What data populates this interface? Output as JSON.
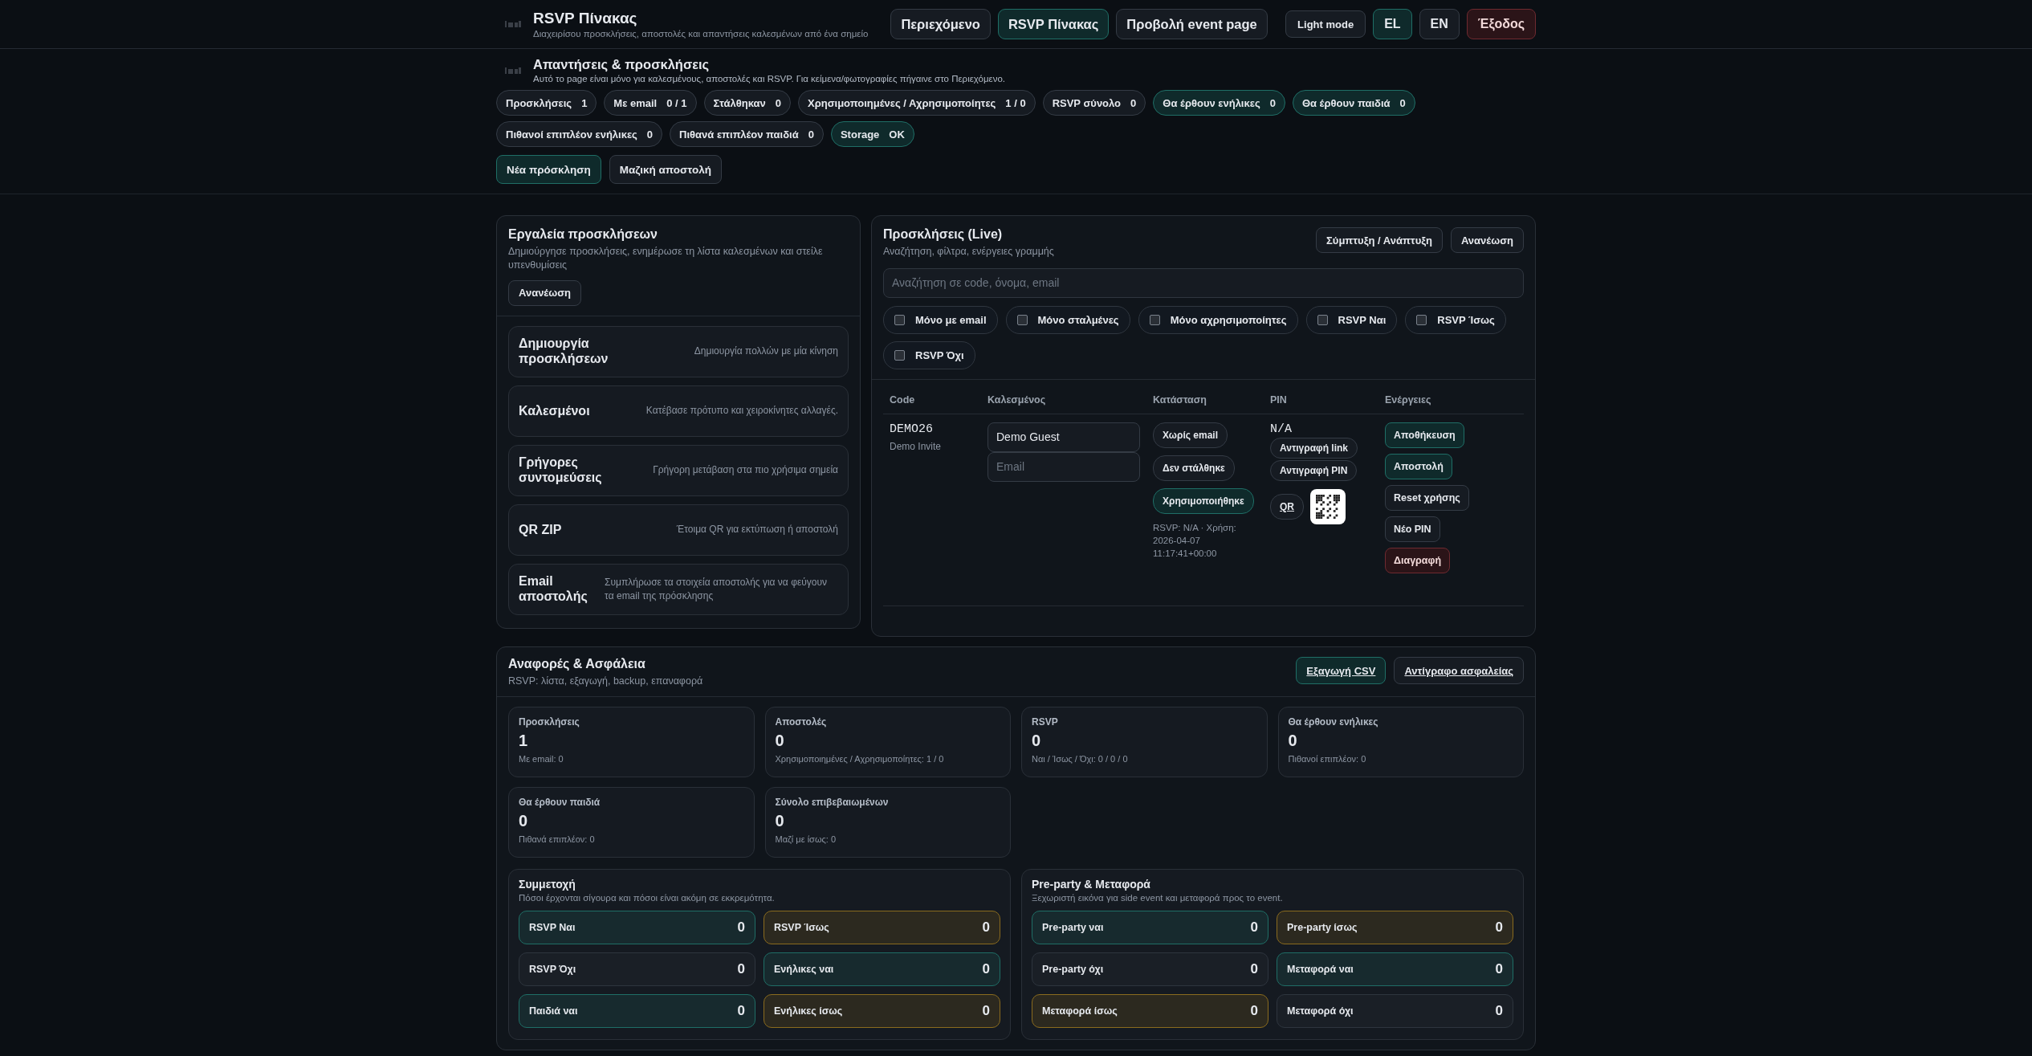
{
  "app": {
    "title": "RSVP Πίνακας",
    "subtitle": "Διαχειρίσου προσκλήσεις, αποστολές και απαντήσεις καλεσμένων από ένα σημείο"
  },
  "nav": [
    {
      "label": "Περιεχόμενο",
      "selected": false
    },
    {
      "label": "RSVP Πίνακας",
      "selected": true
    },
    {
      "label": "Προβολή event page",
      "selected": false
    }
  ],
  "theme_button": "Light mode",
  "languages": [
    {
      "label": "EL",
      "selected": true
    },
    {
      "label": "EN",
      "selected": false
    }
  ],
  "logout": "Έξοδος",
  "section": {
    "title": "Απαντήσεις & προσκλήσεις",
    "subtitle": "Αυτό το page είναι μόνο για καλεσμένους, αποστολές και RSVP. Για κείμενα/φωτογραφίες πήγαινε στο Περιεχόμενο.",
    "chips": [
      {
        "label": "Προσκλήσεις",
        "value": "1",
        "kind": "plain"
      },
      {
        "label": "Με email",
        "value": "0 / 1",
        "kind": "plain"
      },
      {
        "label": "Στάλθηκαν",
        "value": "0",
        "kind": "plain"
      },
      {
        "label": "Χρησιμοποιημένες / Αχρησιμοποίητες",
        "value": "1 / 0",
        "kind": "plain"
      },
      {
        "label": "RSVP σύνολο",
        "value": "0",
        "kind": "plain"
      },
      {
        "label": "Θα έρθουν ενήλικες",
        "value": "0",
        "kind": "accent"
      },
      {
        "label": "Θα έρθουν παιδιά",
        "value": "0",
        "kind": "accent"
      },
      {
        "label": "Πιθανοί επιπλέον ενήλικες",
        "value": "0",
        "kind": "plain"
      },
      {
        "label": "Πιθανά επιπλέον παιδιά",
        "value": "0",
        "kind": "plain"
      },
      {
        "label": "Storage",
        "value": "OK",
        "kind": "accent"
      }
    ],
    "buttons": [
      {
        "label": "Νέα πρόσκληση",
        "kind": "accent"
      },
      {
        "label": "Μαζική αποστολή",
        "kind": "plain"
      }
    ]
  },
  "tools": {
    "title": "Εργαλεία προσκλήσεων",
    "subtitle": "Δημιούργησε προσκλήσεις, ενημέρωσε τη λίστα καλεσμένων και στείλε υπενθυμίσεις",
    "button": "Ανανέωση",
    "items": [
      {
        "title": "Δημιουργία προσκλήσεων",
        "description": "Δημιουργία πολλών με μία κίνηση"
      },
      {
        "title": "Καλεσμένοι",
        "description": "Κατέβασε πρότυπο και χειροκίνητες αλλαγές."
      },
      {
        "title": "Γρήγορες συντομεύσεις",
        "description": "Γρήγορη μετάβαση στα πιο χρήσιμα σημεία"
      },
      {
        "title": "QR ZIP",
        "description": "Έτοιμα QR για εκτύπωση ή αποστολή"
      },
      {
        "title": "Email αποστολής",
        "description": "Συμπλήρωσε τα στοιχεία αποστολής για να φεύγουν τα email της πρόσκλησης"
      }
    ]
  },
  "invitations": {
    "title": "Προσκλήσεις (Live)",
    "subtitle": "Αναζήτηση, φίλτρα, ενέργειες γραμμής",
    "buttons": [
      "Σύμπτυξη / Ανάπτυξη",
      "Ανανέωση"
    ],
    "search": {
      "placeholder": "Αναζήτηση σε code, όνομα, email"
    },
    "filters": [
      {
        "label": "Μόνο με email",
        "checked": false
      },
      {
        "label": "Μόνο σταλμένες",
        "checked": false
      },
      {
        "label": "Μόνο αχρησιμοποίητες",
        "checked": false
      },
      {
        "label": "RSVP Ναι",
        "checked": false
      },
      {
        "label": "RSVP Ίσως",
        "checked": false
      },
      {
        "label": "RSVP Όχι",
        "checked": false
      }
    ],
    "columns": [
      "Code",
      "Καλεσμένος",
      "Κατάσταση",
      "PIN",
      "Ενέργειες"
    ],
    "rows": [
      {
        "code": "DEMO26",
        "invite_name": "Demo Invite",
        "guest_name": "Demo Guest",
        "email_placeholder": "Email",
        "statuses": [
          {
            "label": "Χωρίς email",
            "kind": "plain"
          },
          {
            "label": "Δεν στάλθηκε",
            "kind": "plain"
          },
          {
            "label": "Χρησιμοποιήθηκε",
            "kind": "accent"
          }
        ],
        "note": "RSVP: N/A · Χρήση: 2026-04-07 11:17:41+00:00",
        "pin": "N/A",
        "pin_buttons": [
          "Αντιγραφή link",
          "Αντιγραφή PIN"
        ],
        "qr_link": "QR",
        "actions": [
          {
            "label": "Αποθήκευση",
            "kind": "accent"
          },
          {
            "label": "Αποστολή",
            "kind": "accent"
          },
          {
            "label": "Reset χρήσης",
            "kind": "plain"
          },
          {
            "label": "Νέο PIN",
            "kind": "plain"
          },
          {
            "label": "Διαγραφή",
            "kind": "danger"
          }
        ]
      }
    ]
  },
  "reports": {
    "title": "Αναφορές & Ασφάλεια",
    "subtitle": "RSVP: λίστα, εξαγωγή, backup, επαναφορά",
    "links": [
      {
        "label": "Εξαγωγή CSV",
        "kind": "accent"
      },
      {
        "label": "Αντίγραφο ασφαλείας",
        "kind": "plain"
      }
    ],
    "stats": [
      {
        "label": "Προσκλήσεις",
        "value": "1",
        "note": "Με email: 0"
      },
      {
        "label": "Αποστολές",
        "value": "0",
        "note": "Χρησιμοποιημένες / Αχρησιμοποίητες: 1 / 0"
      },
      {
        "label": "RSVP",
        "value": "0",
        "note": "Ναι / Ίσως / Όχι: 0 / 0 / 0"
      },
      {
        "label": "Θα έρθουν ενήλικες",
        "value": "0",
        "note": "Πιθανοί επιπλέον: 0"
      },
      {
        "label": "Θα έρθουν παιδιά",
        "value": "0",
        "note": "Πιθανά επιπλέον: 0"
      },
      {
        "label": "Σύνολο επιβεβαιωμένων",
        "value": "0",
        "note": "Μαζί με ίσως: 0"
      }
    ],
    "groups": [
      {
        "title": "Συμμετοχή",
        "subtitle": "Πόσοι έρχονται σίγουρα και πόσοι είναι ακόμη σε εκκρεμότητα.",
        "tiles": [
          {
            "label": "RSVP Ναι",
            "value": "0",
            "kind": "accent"
          },
          {
            "label": "RSVP Ίσως",
            "value": "0",
            "kind": "warning"
          },
          {
            "label": "RSVP Όχι",
            "value": "0",
            "kind": "plain"
          },
          {
            "label": "Ενήλικες ναι",
            "value": "0",
            "kind": "accent"
          },
          {
            "label": "Παιδιά ναι",
            "value": "0",
            "kind": "accent"
          },
          {
            "label": "Ενήλικες ίσως",
            "value": "0",
            "kind": "warning"
          }
        ]
      },
      {
        "title": "Pre-party & Μεταφορά",
        "subtitle": "Ξεχωριστή εικόνα για side event και μεταφορά προς το event.",
        "tiles": [
          {
            "label": "Pre-party ναι",
            "value": "0",
            "kind": "accent"
          },
          {
            "label": "Pre-party ίσως",
            "value": "0",
            "kind": "warning"
          },
          {
            "label": "Pre-party όχι",
            "value": "0",
            "kind": "plain"
          },
          {
            "label": "Μεταφορά ναι",
            "value": "0",
            "kind": "accent"
          },
          {
            "label": "Μεταφορά ίσως",
            "value": "0",
            "kind": "warning"
          },
          {
            "label": "Μεταφορά όχι",
            "value": "0",
            "kind": "plain"
          }
        ]
      }
    ]
  }
}
